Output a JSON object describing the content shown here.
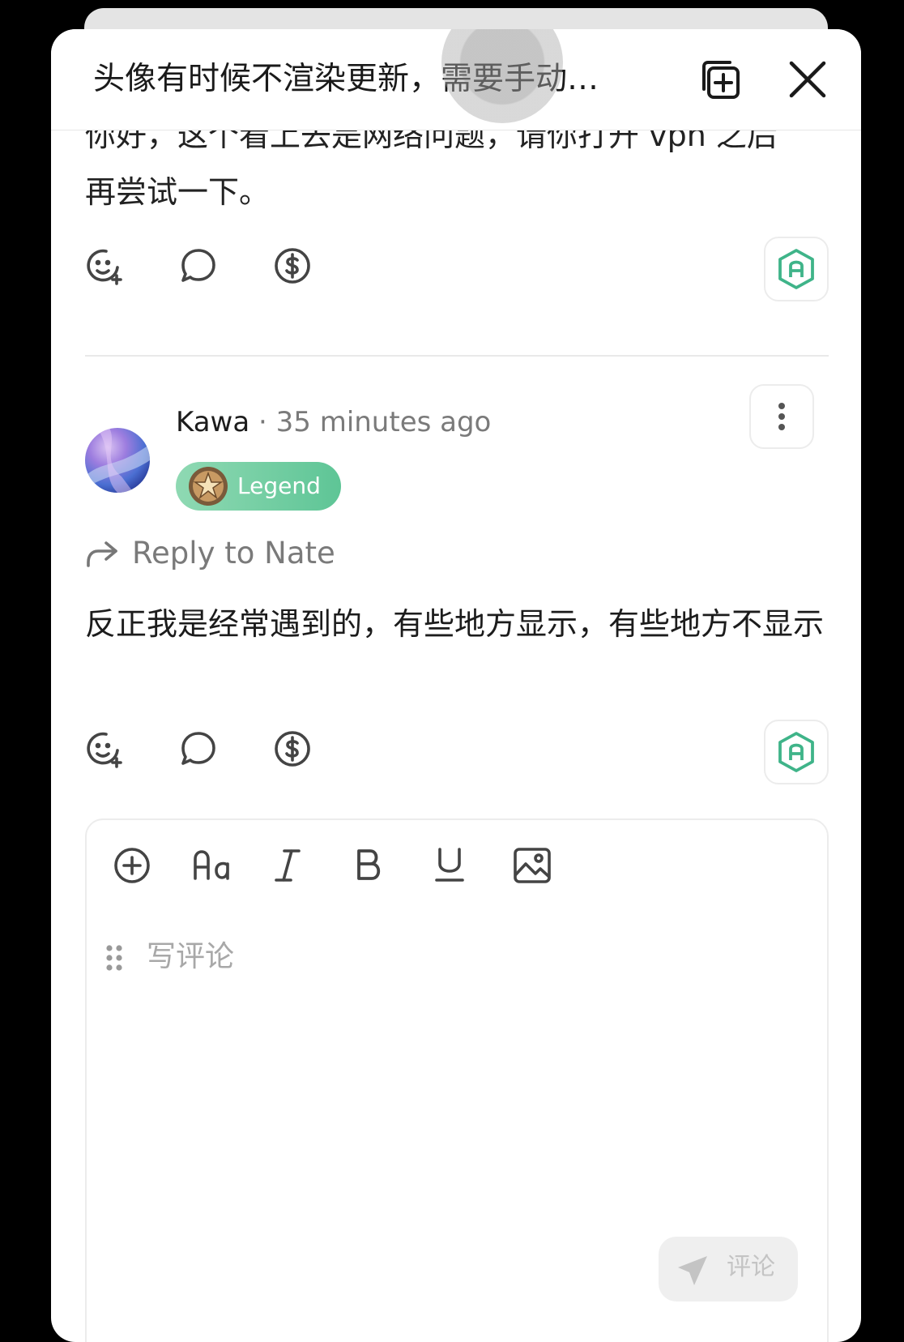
{
  "header": {
    "title": "头像有时候不渲染更新，需要手动…",
    "add_icon": "add-to-collection-icon",
    "close_icon": "close-icon"
  },
  "previous_comment": {
    "body_line1": "你好，这个看上去是网络问题，请你打开 vpn 之后",
    "body_line2": "再尝试一下。"
  },
  "actions": {
    "react_icon": "add-emoji-reaction-icon",
    "comment_icon": "comment-bubble-icon",
    "tip_icon": "dollar-tip-icon",
    "ai_icon": "ai-hexagon-icon"
  },
  "reply": {
    "author": "Kawa",
    "separator": " · ",
    "time": "35 minutes ago",
    "badge": "Legend",
    "reply_to": "Reply to Nate",
    "body": "反正我是经常遇到的，有些地方显示，有些地方不显示"
  },
  "editor": {
    "tools": [
      "add-icon",
      "text-size-icon",
      "italic-icon",
      "bold-icon",
      "underline-icon",
      "image-icon"
    ],
    "placeholder": "写评论",
    "submit_label": "评论"
  },
  "colors": {
    "accent_green": "#3fb489",
    "badge_gradient_start": "#8fd9b3",
    "badge_gradient_end": "#5ec596",
    "muted_text": "#7a7a7a"
  }
}
